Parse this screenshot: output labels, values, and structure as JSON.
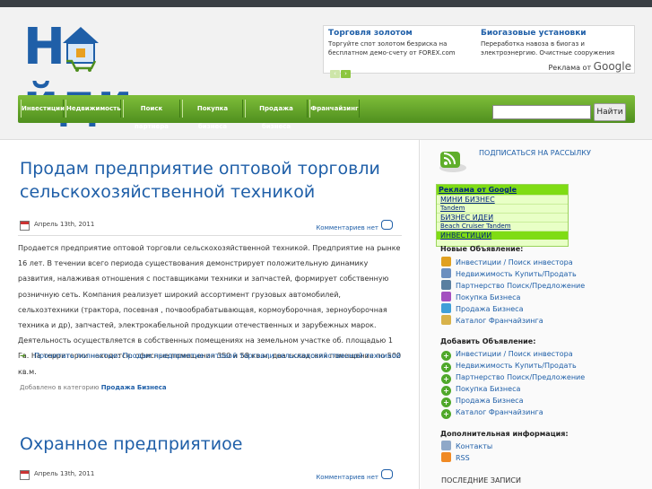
{
  "logo": {
    "left": "Н",
    "right": "йди"
  },
  "top_ads": [
    {
      "title": "Торговля золотом",
      "desc": "Торгуйте спот золотом безриска на бесплатном демо-счету от FOREX.com"
    },
    {
      "title": "Биогазовые установки",
      "desc": "Переработка навоза в биогаз и электроэнергию. Очистные сооружения"
    }
  ],
  "ads_by": {
    "prefix": "Реклама от",
    "brand": "Google"
  },
  "nav": [
    "Инвестиции",
    "Недвижимость",
    "Поиск партнера",
    "Покупка бизнеса",
    "Продажа бизнеса",
    "Франчайзинг"
  ],
  "search": {
    "button": "Найти",
    "value": ""
  },
  "posts": [
    {
      "title_line1": "Продам предприятие оптовой торговли",
      "title_line2": "сельскохозяйственной техникой",
      "date": "Апрель 13th, 2011",
      "comments": "Комментариев нет",
      "body": "Продается предприятие оптовой торговли сельскохозяйственной техникой. Предприятие на рынке 16 лет. В течении всего периода существования демонстрирует положительную динамику развития, налаживая отношения с поставщиками техники и запчастей, формирует собственную розничную сеть. Компания реализует широкий ассортимент грузовых автомобилей, сельхозтехники (трактора, посевная , почвообрабатывающая, кормоуборочная, зерноуборочная техника и др), запчастей, электрокабельной продукции отечественных и зарубежных марок. Деятельность осуществляется в собственных помещениях на земельном участке об. площадью 1 Га. На территории находится: офисные помещения 350 и 58 кв.м, два складских помещения по 500 кв.м.",
      "read_more": "Прочитать полностью: Продам предприятие оптовой торговли сельскохозяйственной техникой",
      "category_prefix": "Добавлено в категорию",
      "category": "Продажа Бизнеса"
    },
    {
      "title_line1": "Охранное предприятиое",
      "date": "Апрель 13th, 2011",
      "comments": "Комментариев нет"
    }
  ],
  "sidebar": {
    "subscribe": "ПОДПИСАТЬСЯ НА РАССЫЛКУ",
    "ads": {
      "header": "Реклама от Google",
      "items": [
        "МИНИ БИЗНЕС",
        "Tandem",
        "БИЗНЕС ИДЕИ",
        "Beach Cruiser Tandem",
        "ИНВЕСТИЦИИ"
      ]
    },
    "new_ads_head": "Новые Объявление:",
    "new_ads": [
      "Инвестиции / Поиск инвестора",
      "Недвижимость Купить/Продать",
      "Партнерство Поиск/Предложение",
      "Покупка Бизнеса",
      "Продажа Бизнеса",
      "Каталог Франчайзинга"
    ],
    "add_head": "Добавить Объявление:",
    "add_ads": [
      "Инвестиции / Поиск инвестора",
      "Недвижимость Купить/Продать",
      "Партнерство Поиск/Предложение",
      "Покупка Бизнеса",
      "Продажа Бизнеса",
      "Каталог Франчайзинга"
    ],
    "extra_head": "Дополнительная информация:",
    "extra": [
      "Контакты",
      "RSS"
    ],
    "last_posts": "ПОСЛЕДНИЕ ЗАПИСИ"
  }
}
